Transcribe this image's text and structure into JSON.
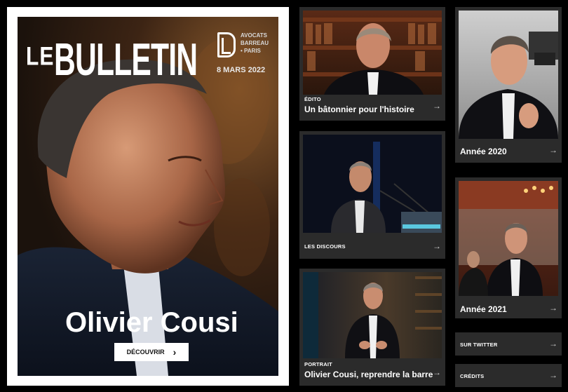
{
  "hero": {
    "le": "LE",
    "bulletin": "BULLETIN",
    "brand_line1": "AVOCATS",
    "brand_line2": "BARREAU",
    "brand_line3": "• PARIS",
    "date": "8 MARS 2022",
    "name": "Olivier Cousi",
    "button_label": "DÉCOUVRIR"
  },
  "cards": [
    {
      "kicker": "ÉDITO",
      "title": "Un bâtonnier pour l'histoire"
    },
    {
      "kicker": "",
      "title": "Année 2020"
    },
    {
      "kicker": "LES DISCOURS",
      "title": ""
    },
    {
      "kicker": "",
      "title": "Année 2021"
    },
    {
      "kicker": "PORTRAIT",
      "title": "Olivier Cousi, reprendre la barre"
    },
    {
      "kicker": "SUR TWITTER",
      "title": ""
    },
    {
      "kicker": "CRÉDITS",
      "title": ""
    }
  ],
  "arrow_glyph": "→",
  "colors": {
    "accent": "#ffffff",
    "card_bg": "#2b2b2b",
    "page_bg": "#000000"
  }
}
